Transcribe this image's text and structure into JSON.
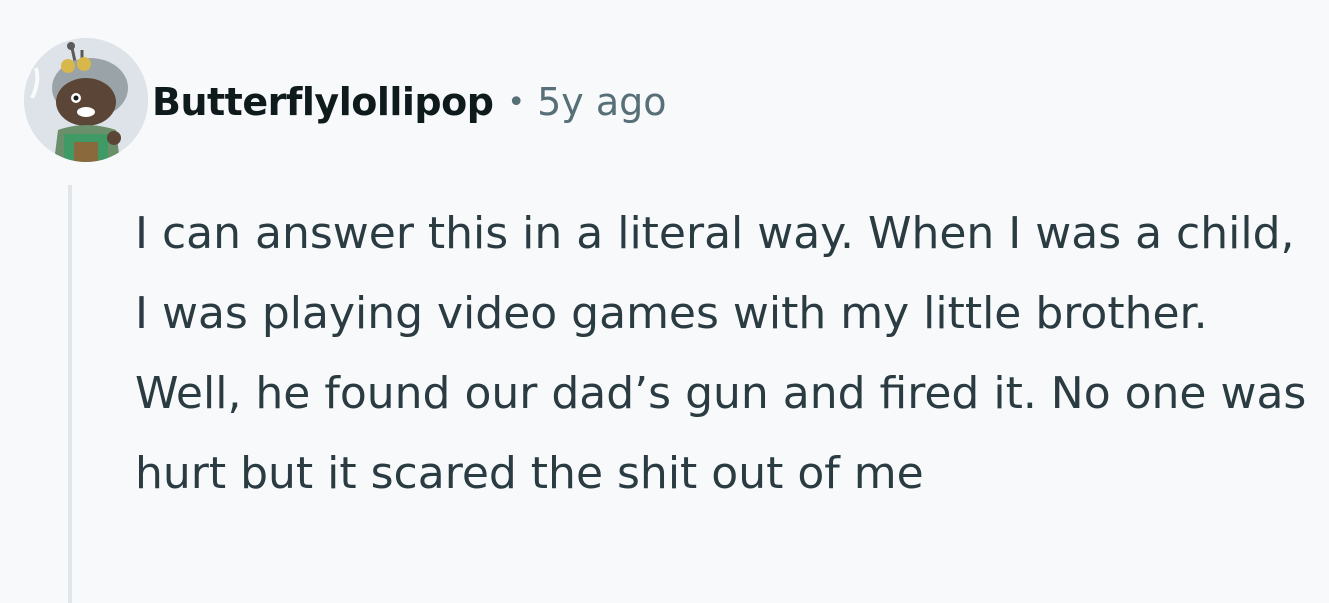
{
  "comment": {
    "author": "Butterflylollipop",
    "separator": "•",
    "timestamp": "5y ago",
    "avatar_icon": "snoo-avatar-icon",
    "body": "I can answer this in a literal way. When I was a child, I was playing video games with my little brother. Well, he found our dad’s gun and fired it. No one was hurt but it scared the shit out of me"
  },
  "colors": {
    "background": "#f7f9fb",
    "author": "#0f1a1c",
    "meta": "#576f76",
    "body": "#2a3c42",
    "thread_line": "#dfe5e8"
  }
}
